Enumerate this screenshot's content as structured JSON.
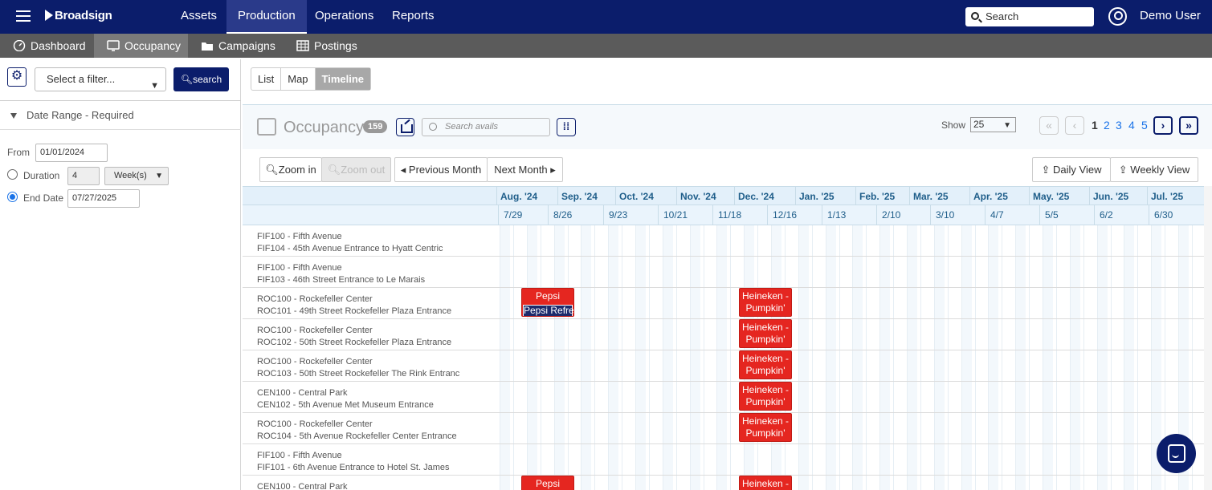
{
  "topbar": {
    "logo": "Broadsign",
    "nav": [
      "Assets",
      "Production",
      "Operations",
      "Reports"
    ],
    "active_nav": "Production",
    "search_placeholder": "Search",
    "user": "Demo User"
  },
  "subnav": {
    "items": [
      "Dashboard",
      "Occupancy",
      "Campaigns",
      "Postings"
    ],
    "active": "Occupancy"
  },
  "filters": {
    "select_placeholder": "Select a filter...",
    "search_button": "search",
    "date_range_label": "Date Range - Required",
    "from_label": "From",
    "from_value": "01/01/2024",
    "duration_label": "Duration",
    "duration_value": "4",
    "duration_unit": "Week(s)",
    "end_date_label": "End Date",
    "end_date_value": "07/27/2025",
    "selected_mode": "End Date"
  },
  "view_tabs": [
    "List",
    "Map",
    "Timeline"
  ],
  "active_view": "Timeline",
  "occupancy": {
    "title": "Occupancy",
    "count": "159",
    "search_placeholder": "Search avails",
    "show_label": "Show",
    "page_size": "25",
    "pages": [
      "1",
      "2",
      "3",
      "4",
      "5"
    ],
    "current_page": "1"
  },
  "timeline_controls": {
    "zoom_in": "Zoom in",
    "zoom_out": "Zoom out",
    "previous_month": "◂ Previous Month",
    "next_month": "Next Month ▸",
    "daily_view": "Daily View",
    "weekly_view": "Weekly View"
  },
  "timeline": {
    "months": [
      "Aug. '24",
      "Sep. '24",
      "Oct. '24",
      "Nov. '24",
      "Dec. '24",
      "Jan. '25",
      "Feb. '25",
      "Mar. '25",
      "Apr. '25",
      "May. '25",
      "Jun. '25",
      "Jul. '25"
    ],
    "weeks": [
      "7/29",
      "8/26",
      "9/23",
      "10/21",
      "11/18",
      "12/16",
      "1/13",
      "2/10",
      "3/10",
      "4/7",
      "5/5",
      "6/2",
      "6/30"
    ],
    "rows": [
      {
        "site": "FIF100 - Fifth Avenue",
        "face": "FIF104 - 45th Avenue Entrance to Hyatt Centric"
      },
      {
        "site": "FIF100 - Fifth Avenue",
        "face": "FIF103 - 46th Street Entrance to Le Marais"
      },
      {
        "site": "ROC100 - Rockefeller Center",
        "face": "ROC101 - 49th Street Rockefeller Plaza Entrance"
      },
      {
        "site": "ROC100 - Rockefeller Center",
        "face": "ROC102 - 50th Street Rockefeller Plaza Entrance"
      },
      {
        "site": "ROC100 - Rockefeller Center",
        "face": "ROC103 - 50th Street Rockefeller The Rink Entranc"
      },
      {
        "site": "CEN100 - Central Park",
        "face": "CEN102 - 5th Avenue Met Museum Entrance"
      },
      {
        "site": "ROC100 - Rockefeller Center",
        "face": "ROC104 - 5th Avenue Rockefeller Center Entrance"
      },
      {
        "site": "FIF100 - Fifth Avenue",
        "face": "FIF101 - 6th Avenue Entrance to Hotel St. James"
      },
      {
        "site": "CEN100 - Central Park",
        "face": ""
      }
    ],
    "bookings": {
      "pepsi": "Pepsi",
      "pepsi_sub": "Pepsi Refres",
      "heineken_1": "Heineken -",
      "heineken_2": "Pumpkin'"
    }
  },
  "colors": {
    "brand_navy": "#0b1d6b",
    "booking_red": "#e52620",
    "subnav_gray": "#5b5b5b"
  }
}
